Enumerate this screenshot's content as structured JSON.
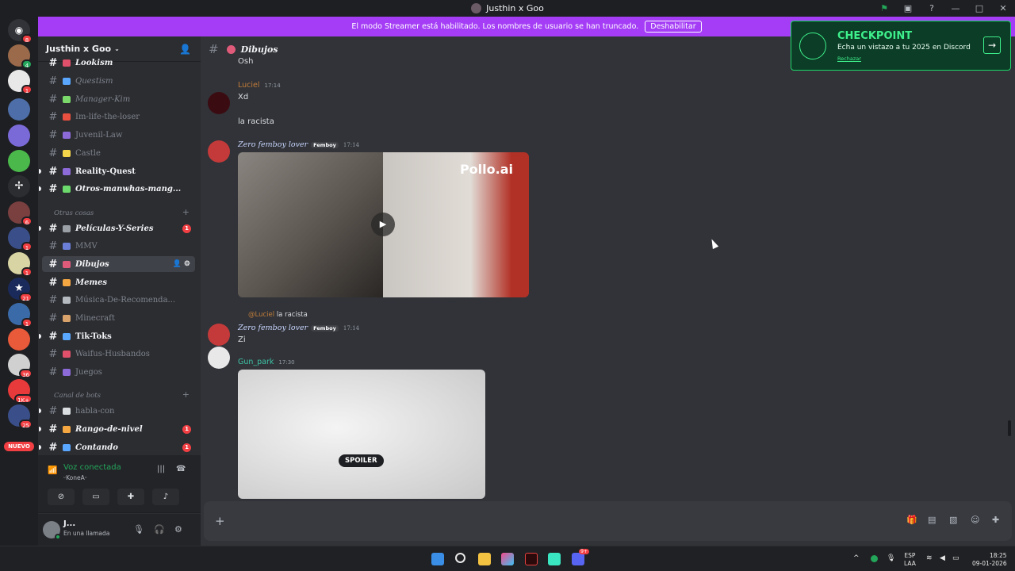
{
  "window": {
    "title": "Justhin x Goo"
  },
  "banner": {
    "text": "El modo Streamer está habilitado. Los nombres de usuario se han truncado.",
    "button": "Deshabilitar"
  },
  "guilds": [
    {
      "badge": "8"
    },
    {
      "badge": "4"
    },
    {
      "badge": "1"
    },
    {
      "badge": ""
    },
    {
      "badge": ""
    },
    {
      "badge": ""
    },
    {
      "badge": ""
    },
    {
      "badge": "6"
    },
    {
      "badge": "1"
    },
    {
      "badge": "1"
    },
    {
      "badge": "21"
    },
    {
      "badge": "1"
    },
    {
      "badge": ""
    },
    {
      "badge": "36"
    },
    {
      "badge": "1K+"
    },
    {
      "badge": "25"
    }
  ],
  "guild_new_label": "NUEVO",
  "server": {
    "name": "Justhin x Goo"
  },
  "channels": [
    {
      "name": "Lookism",
      "color": "#e0506a"
    },
    {
      "name": "Questism",
      "color": "#5aa7ff"
    },
    {
      "name": "Manager-Kim",
      "color": "#7bd96b"
    },
    {
      "name": "Im-life-the-loser",
      "color": "#e9503f"
    },
    {
      "name": "Juvenil-Law",
      "color": "#8c6ad8"
    },
    {
      "name": "Castle",
      "color": "#f5d54a"
    },
    {
      "name": "Reality-Quest",
      "color": "#8c6ad8"
    },
    {
      "name": "Otros-manwhas-mang...",
      "color": "#6bd96b"
    },
    {
      "name": "Películas-Y-Series",
      "color": "#9aa0a6",
      "badge": "1"
    },
    {
      "name": "MMV",
      "color": "#6b7fd9"
    },
    {
      "name": "Dibujos",
      "color": "#e05a7a"
    },
    {
      "name": "Memes",
      "color": "#f5a742"
    },
    {
      "name": "Música-De-Recomenda...",
      "color": "#b5bac1"
    },
    {
      "name": "Minecraft",
      "color": "#d9a36b"
    },
    {
      "name": "Tik-Toks",
      "color": "#5aa7ff"
    },
    {
      "name": "Waifus-Husbandos",
      "color": "#e0506a"
    },
    {
      "name": "Juegos",
      "color": "#8c6ad8"
    },
    {
      "name": "habla-con",
      "color": "#dbdee1"
    },
    {
      "name": "Rango-de-nivel",
      "color": "#f5a742",
      "badge": "1"
    },
    {
      "name": "Contando",
      "color": "#5aa7ff",
      "badge": "1"
    }
  ],
  "categories": {
    "otras": "Otras cosas",
    "bots": "Canal de bots"
  },
  "voice": {
    "title": "Voz conectada",
    "sub": "ᵕKoneAᵕ"
  },
  "user": {
    "name": "J...",
    "status": "En una llamada"
  },
  "channel_header": {
    "name": "Dibujos"
  },
  "messages": {
    "top_partial": "Osh",
    "m1": {
      "author": "Luciel",
      "time": "17:14",
      "line1": "Xd",
      "line2": "la racista"
    },
    "m2": {
      "author": "Zero femboy lover",
      "tag": "Femboy",
      "time": "17:14",
      "image_logo": "Pollo.ai"
    },
    "reply": {
      "mention": "@Luciel",
      "text": "la racista"
    },
    "m3": {
      "author": "Zero femboy lover",
      "tag": "Femboy",
      "time": "17:14",
      "text": "Zi"
    },
    "m4": {
      "author": "Gun_park",
      "time": "17:30",
      "spoiler": "SPOILER"
    }
  },
  "toast": {
    "title": "CHECKPOINT",
    "desc": "Echa un vistazo a tu 2025 en Discord",
    "dismiss": "Rechazar"
  },
  "taskbar": {
    "lang1": "ESP",
    "lang2": "LAA",
    "time": "18:25",
    "date": "09-01-2026",
    "discord_badge": "9+"
  }
}
